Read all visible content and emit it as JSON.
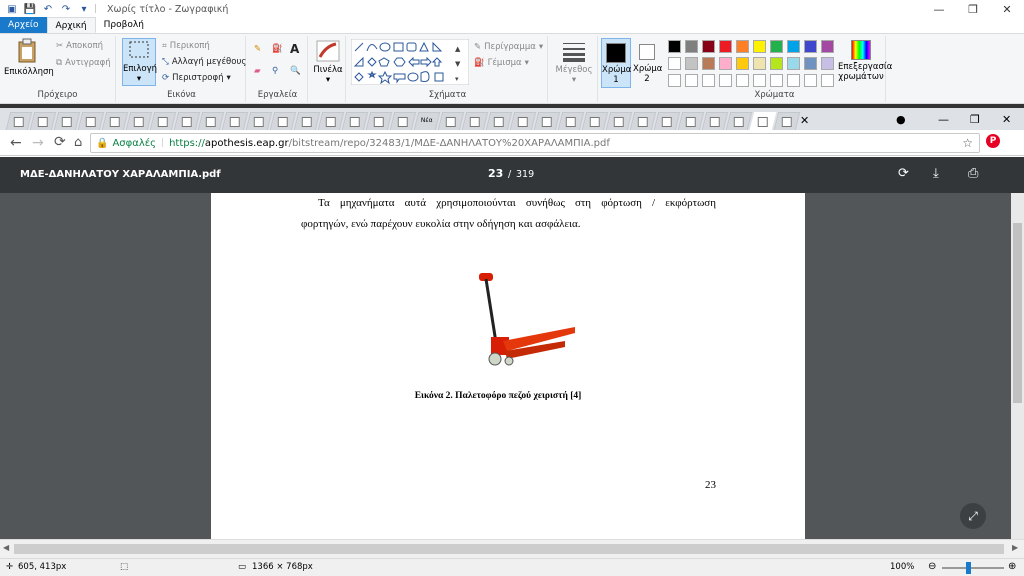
{
  "window": {
    "title": "Χωρίς τίτλο - Ζωγραφική",
    "separator": "|"
  },
  "ribbon_tabs": [
    "Αρχείο",
    "Αρχική",
    "Προβολή"
  ],
  "ribbon": {
    "clipboard": {
      "paste": "Επικόλληση",
      "cut": "Αποκοπή",
      "copy": "Αντιγραφή",
      "label": "Πρόχειρο"
    },
    "image": {
      "select": "Επιλογή",
      "crop": "Περικοπή",
      "resize": "Αλλαγή μεγέθους",
      "rotate": "Περιστροφή",
      "label": "Εικόνα"
    },
    "tools": {
      "label": "Εργαλεία",
      "text_glyph": "A"
    },
    "brushes": {
      "label": "Πινέλα"
    },
    "shapes": {
      "outline": "Περίγραμμα",
      "fill": "Γέμισμα",
      "label": "Σχήματα"
    },
    "size": {
      "label": "Μέγεθος"
    },
    "color1": {
      "label": "Χρώμα",
      "num": "1"
    },
    "color2": {
      "label": "Χρώμα",
      "num": "2"
    },
    "colors": {
      "label": "Χρώματα",
      "edit_line1": "Επεξεργασία",
      "edit_line2": "χρωμάτων"
    }
  },
  "palette_row1": [
    "#000000",
    "#7f7f7f",
    "#880015",
    "#ed1c24",
    "#ff7f27",
    "#fff200",
    "#22b14c",
    "#00a2e8",
    "#3f48cc",
    "#a349a4"
  ],
  "palette_row2": [
    "#ffffff",
    "#c3c3c3",
    "#b97a57",
    "#ffaec9",
    "#ffc90e",
    "#efe4b0",
    "#b5e61d",
    "#99d9ea",
    "#7092be",
    "#c8bfe7"
  ],
  "browser": {
    "new_tab_label": "Νέα",
    "secure_label": "Ασφαλές",
    "url_prefix": "https://",
    "url_host": "apothesis.eap.gr",
    "url_path": "/bitstream/repo/32483/1/ΜΔΕ-ΔΑΝΗΛΑΤΟΥ%20ΧΑΡΑΛΑΜΠΙΑ.pdf"
  },
  "pdf": {
    "filename": "ΜΔΕ-ΔΑΝΗΛΑΤΟΥ ΧΑΡΑΛΑΜΠΙΑ.pdf",
    "current_page": "23",
    "page_sep": "/",
    "total_pages": "319",
    "text_line1": "Τα μηχανήματα αυτά χρησιμοποιούνται συνήθως στη φόρτωση / εκφόρτωση",
    "text_line2": "φορτηγών, ενώ παρέχουν ευκολία στην οδήγηση και ασφάλεια.",
    "caption": "Εικόνα 2. Παλετοφόρο πεζού χειριστή [4]",
    "page_number": "23"
  },
  "status": {
    "cursor": "605, 413px",
    "canvas_size": "1366 × 768px",
    "zoom": "100%"
  },
  "colors": {
    "file_tab": "#1979ca",
    "pdf_toolbar": "#323639",
    "pdf_bg": "#525659",
    "secure_green": "#0b8043"
  }
}
